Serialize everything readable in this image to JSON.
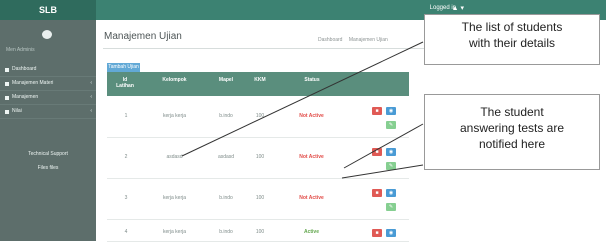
{
  "app": {
    "name": "SLB",
    "logged_in": "Logged in",
    "user_icon": "▲ ▾"
  },
  "sidebar": {
    "subtitle": "Men Adminis",
    "items": [
      {
        "label": "Dashboard"
      },
      {
        "label": "Manajemen Materi"
      },
      {
        "label": "Manajemen"
      },
      {
        "label": "Nilai"
      }
    ],
    "technical_support": "Technical Support",
    "files": "Files files"
  },
  "page": {
    "title": "Manajemen Ujian",
    "breadcrumbs": [
      "Dashboard",
      "Manajemen Ujian"
    ]
  },
  "tab": {
    "label": "Tambah Ujian"
  },
  "table": {
    "headers": [
      "Id Latihan",
      "Kelompok",
      "Mapel",
      "KKM",
      "Status"
    ],
    "rows": [
      {
        "id": "1",
        "kelompok": "kerja kerja",
        "mapel": "b.indo",
        "kkm": "100",
        "status": "Not Active"
      },
      {
        "id": "2",
        "kelompok": "asdasd",
        "mapel": "asdasd",
        "kkm": "100",
        "status": "Not Active"
      },
      {
        "id": "3",
        "kelompok": "kerja kerja",
        "mapel": "b.indo",
        "kkm": "100",
        "status": "Not Active"
      },
      {
        "id": "4",
        "kelompok": "kerja kerja",
        "mapel": "b.indo",
        "kkm": "100",
        "status": "Active"
      }
    ]
  },
  "callouts": [
    {
      "text_line1": "The list of students",
      "text_line2": "with their details"
    },
    {
      "text_line1": "The student",
      "text_line2": "answering tests are",
      "text_line3": "notified here"
    }
  ],
  "icons": {
    "edit": "✎",
    "delete": "■",
    "open": "◉"
  }
}
